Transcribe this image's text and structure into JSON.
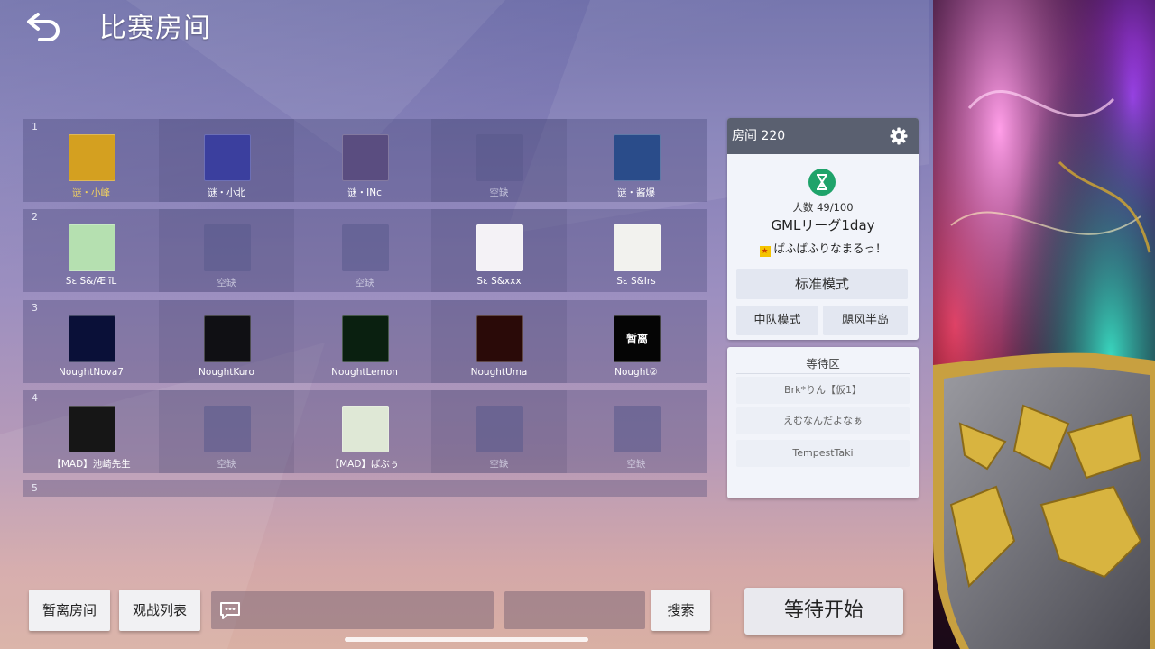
{
  "header": {
    "title": "比赛房间",
    "back_icon": "back-arrow-icon"
  },
  "teams": [
    {
      "number": "1",
      "slots": [
        {
          "name": "谜・小峰",
          "filled": true,
          "color": "#d4a020",
          "style": "gold"
        },
        {
          "name": "谜・小北",
          "filled": true,
          "color": "#3b3f9e",
          "style": "normal"
        },
        {
          "name": "谜・INc",
          "filled": true,
          "color": "#5a4d80",
          "style": "normal"
        },
        {
          "name": "空缺",
          "filled": false,
          "style": "dim"
        },
        {
          "name": "谜・酱爆",
          "filled": true,
          "color": "#2a4c8a",
          "style": "normal"
        }
      ]
    },
    {
      "number": "2",
      "slots": [
        {
          "name": "Sε S&/Æ ĩL",
          "filled": true,
          "color": "#b5e0b0",
          "style": "normal"
        },
        {
          "name": "空缺",
          "filled": false,
          "style": "dim"
        },
        {
          "name": "空缺",
          "filled": false,
          "style": "dim"
        },
        {
          "name": "Sε S&xxx",
          "filled": true,
          "color": "#f4f2f6",
          "style": "normal"
        },
        {
          "name": "Sε S&Irs",
          "filled": true,
          "color": "#f2f2ee",
          "style": "normal"
        }
      ]
    },
    {
      "number": "3",
      "slots": [
        {
          "name": "NoughtNova7",
          "filled": true,
          "color": "#0a1038",
          "style": "normal"
        },
        {
          "name": "NoughtKuro",
          "filled": true,
          "color": "#101014",
          "style": "normal"
        },
        {
          "name": "NoughtLemon",
          "filled": true,
          "color": "#0a2010",
          "style": "normal"
        },
        {
          "name": "NoughtUma",
          "filled": true,
          "color": "#2a0a08",
          "style": "normal"
        },
        {
          "name": "Nought②",
          "filled": true,
          "color": "#050505",
          "style": "normal",
          "avatar_text": "暂离"
        }
      ]
    },
    {
      "number": "4",
      "slots": [
        {
          "name": "【MAD】池崎先生",
          "filled": true,
          "color": "#161616",
          "style": "normal"
        },
        {
          "name": "空缺",
          "filled": false,
          "style": "dim"
        },
        {
          "name": "【MAD】ばぶぅ",
          "filled": true,
          "color": "#dfe8d6",
          "style": "normal"
        },
        {
          "name": "空缺",
          "filled": false,
          "style": "dim"
        },
        {
          "name": "空缺",
          "filled": false,
          "style": "dim"
        }
      ]
    },
    {
      "number": "5",
      "slots": []
    }
  ],
  "room": {
    "title": "房间 220",
    "count_label": "人数 49/100",
    "name": "GMLリーグ1day",
    "host": "ばふばふりなまるっ！",
    "mode_main": "标准模式",
    "mode_team": "中队模式",
    "map": "飓风半岛"
  },
  "waiting": {
    "title": "等待区",
    "players": [
      "Brk*りん【仮1】",
      "えむなんだよなぁ",
      "TempestTaki"
    ]
  },
  "footer": {
    "leave_label": "暂离房间",
    "spectate_label": "观战列表",
    "search_label": "搜索",
    "start_label": "等待开始"
  },
  "colors": {
    "accent_green": "#1fa36a",
    "header_gray": "#5a6070",
    "gold_name": "#f0d060"
  }
}
